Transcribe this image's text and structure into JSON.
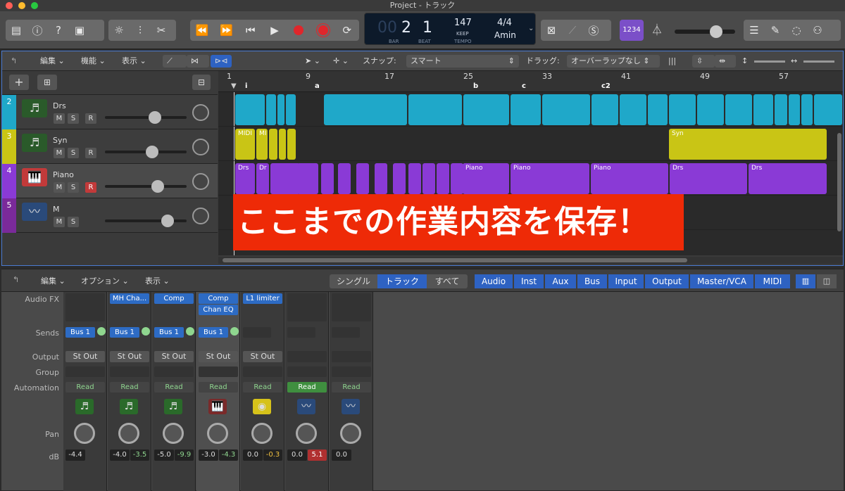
{
  "window": {
    "title": "Project - トラック"
  },
  "toolbar": {
    "lcd": {
      "bar": "2",
      "beat": "1",
      "bar_label": "BAR",
      "beat_label": "BEAT",
      "tempo": "147",
      "keep": "KEEP",
      "tempo_label": "TEMPO",
      "sig": "4/4",
      "key": "Amin",
      "pre": "00"
    },
    "counter_label": "1234"
  },
  "tracks_toolbar": {
    "edit": "編集",
    "function": "機能",
    "view": "表示",
    "snap_label": "スナップ:",
    "snap_value": "スマート",
    "drag_label": "ドラッグ:",
    "drag_value": "オーバーラップなし"
  },
  "ruler": {
    "bars": [
      "1",
      "9",
      "17",
      "25",
      "33",
      "41",
      "49",
      "57"
    ],
    "markers": [
      "i",
      "a",
      "b",
      "c",
      "c2"
    ]
  },
  "tracks": [
    {
      "num": "2",
      "name": "Drs",
      "icon": "♬",
      "m": "M",
      "s": "S",
      "r": "R",
      "color": "#1fa8c9"
    },
    {
      "num": "3",
      "name": "Syn",
      "icon": "♬",
      "m": "M",
      "s": "S",
      "r": "R",
      "color": "#c9c515"
    },
    {
      "num": "4",
      "name": "Piano",
      "icon": "🎹",
      "m": "M",
      "s": "S",
      "r": "R",
      "color": "#8a3ad6"
    },
    {
      "num": "5",
      "name": "M",
      "icon": "〰",
      "m": "M",
      "s": "S",
      "color": "#7a2a9a"
    }
  ],
  "regions": {
    "syn_a": "MIDI",
    "syn_b": "MI",
    "syn_c": "Syn",
    "pno_a": "Drs",
    "pno_b": "Dr",
    "pno_c": "Piano",
    "pno_d": "Piano",
    "pno_e": "Piano",
    "pno_f": "Drs",
    "pno_g": "Drs"
  },
  "banner": "ここまでの作業内容を保存！",
  "mixer": {
    "edit": "編集",
    "options": "オプション",
    "view": "表示",
    "single": "シングル",
    "track": "トラック",
    "all": "すべて",
    "filters": [
      "Audio",
      "Inst",
      "Aux",
      "Bus",
      "Input",
      "Output",
      "Master/VCA",
      "MIDI"
    ],
    "labels": {
      "audio_fx": "Audio FX",
      "sends": "Sends",
      "output": "Output",
      "group": "Group",
      "automation": "Automation",
      "pan": "Pan",
      "db": "dB"
    },
    "strips": [
      {
        "fx": "",
        "fx2": "",
        "send": "Bus 1",
        "output": "St Out",
        "auto": "Read",
        "icon": "♬",
        "db1": "-4.4",
        "db2": ""
      },
      {
        "fx": "MH Cha...",
        "fx2": "",
        "send": "Bus 1",
        "output": "St Out",
        "auto": "Read",
        "icon": "♬",
        "db1": "-4.0",
        "db2": "-3.5"
      },
      {
        "fx": "Comp",
        "fx2": "",
        "send": "Bus 1",
        "output": "St Out",
        "auto": "Read",
        "icon": "♬",
        "db1": "-5.0",
        "db2": "-9.9"
      },
      {
        "fx": "Comp",
        "fx2": "Chan EQ",
        "send": "Bus 1",
        "output": "St Out",
        "auto": "Read",
        "icon": "🎹",
        "db1": "-3.0",
        "db2": "-4.3"
      },
      {
        "fx": "L1 limiter",
        "fx2": "",
        "send": "",
        "output": "St Out",
        "auto": "Read",
        "icon": "◉",
        "db1": "0.0",
        "db2": "-0.3"
      },
      {
        "fx": "",
        "fx2": "",
        "send": "",
        "output": "",
        "auto": "Read",
        "icon": "〰",
        "db1": "0.0",
        "db2": "5.1"
      },
      {
        "fx": "",
        "fx2": "",
        "send": "",
        "output": "",
        "auto": "Read",
        "icon": "〰",
        "db1": "0.0",
        "db2": ""
      }
    ]
  }
}
